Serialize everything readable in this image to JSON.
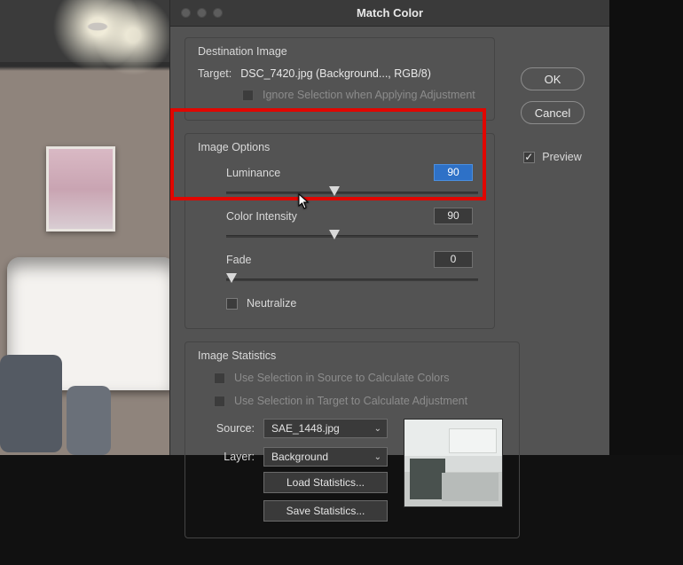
{
  "dialog": {
    "title": "Match Color",
    "ok": "OK",
    "cancel": "Cancel",
    "preview_label": "Preview",
    "preview_checked": true
  },
  "destination": {
    "legend": "Destination Image",
    "target_label": "Target:",
    "target_value": "DSC_7420.jpg (Background..., RGB/8)",
    "ignore_label": "Ignore Selection when Applying Adjustment",
    "ignore_enabled": false
  },
  "options": {
    "legend": "Image Options",
    "luminance": {
      "label": "Luminance",
      "value": "90",
      "pos_pct": 43
    },
    "intensity": {
      "label": "Color Intensity",
      "value": "90",
      "pos_pct": 43
    },
    "fade": {
      "label": "Fade",
      "value": "0",
      "pos_pct": 2
    },
    "neutralize_label": "Neutralize",
    "neutralize_checked": false
  },
  "stats": {
    "legend": "Image Statistics",
    "use_source": "Use Selection in Source to Calculate Colors",
    "use_target": "Use Selection in Target to Calculate Adjustment",
    "source_label": "Source:",
    "source_value": "SAE_1448.jpg",
    "layer_label": "Layer:",
    "layer_value": "Background",
    "load_btn": "Load Statistics...",
    "save_btn": "Save Statistics..."
  }
}
